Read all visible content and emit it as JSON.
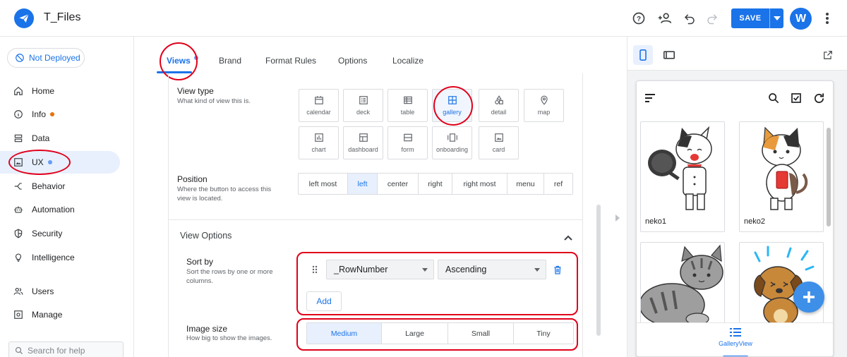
{
  "app": {
    "title": "T_Files",
    "save_label": "SAVE",
    "avatar_initial": "W",
    "accent": "#1a73e8"
  },
  "sidebar": {
    "deploy_status": "Not Deployed",
    "items": [
      {
        "label": "Home",
        "icon": "home-icon"
      },
      {
        "label": "Info",
        "icon": "info-icon",
        "dot": "orange"
      },
      {
        "label": "Data",
        "icon": "database-icon"
      },
      {
        "label": "UX",
        "icon": "image-icon",
        "dot": "blue",
        "active": true
      },
      {
        "label": "Behavior",
        "icon": "branch-icon"
      },
      {
        "label": "Automation",
        "icon": "robot-icon"
      },
      {
        "label": "Security",
        "icon": "shield-icon"
      },
      {
        "label": "Intelligence",
        "icon": "bulb-icon"
      },
      {
        "label": "Users",
        "icon": "users-icon"
      },
      {
        "label": "Manage",
        "icon": "manage-icon"
      }
    ],
    "search_placeholder": "Search for help"
  },
  "tabs": [
    "Views",
    "Brand",
    "Format Rules",
    "Options",
    "Localize"
  ],
  "view_type": {
    "title": "View type",
    "desc": "What kind of view this is.",
    "options": [
      "calendar",
      "deck",
      "table",
      "gallery",
      "detail",
      "map",
      "chart",
      "dashboard",
      "form",
      "onboarding",
      "card"
    ],
    "selected": "gallery"
  },
  "position": {
    "title": "Position",
    "desc": "Where the button to access this view is located.",
    "options": [
      "left most",
      "left",
      "center",
      "right",
      "right most",
      "menu",
      "ref"
    ],
    "selected": "left"
  },
  "view_options": {
    "title": "View Options"
  },
  "sort_by": {
    "title": "Sort by",
    "desc": "Sort the rows by one or more columns.",
    "column": "_RowNumber",
    "order": "Ascending",
    "add_label": "Add"
  },
  "image_size": {
    "title": "Image size",
    "desc": "How big to show the images.",
    "options": [
      "Medium",
      "Large",
      "Small",
      "Tiny"
    ],
    "selected": "Medium"
  },
  "preview": {
    "cards": [
      {
        "name": "neko1"
      },
      {
        "name": "neko2"
      },
      {
        "name": ""
      },
      {
        "name": ""
      }
    ],
    "bottom_nav_label": "GalleryView"
  }
}
